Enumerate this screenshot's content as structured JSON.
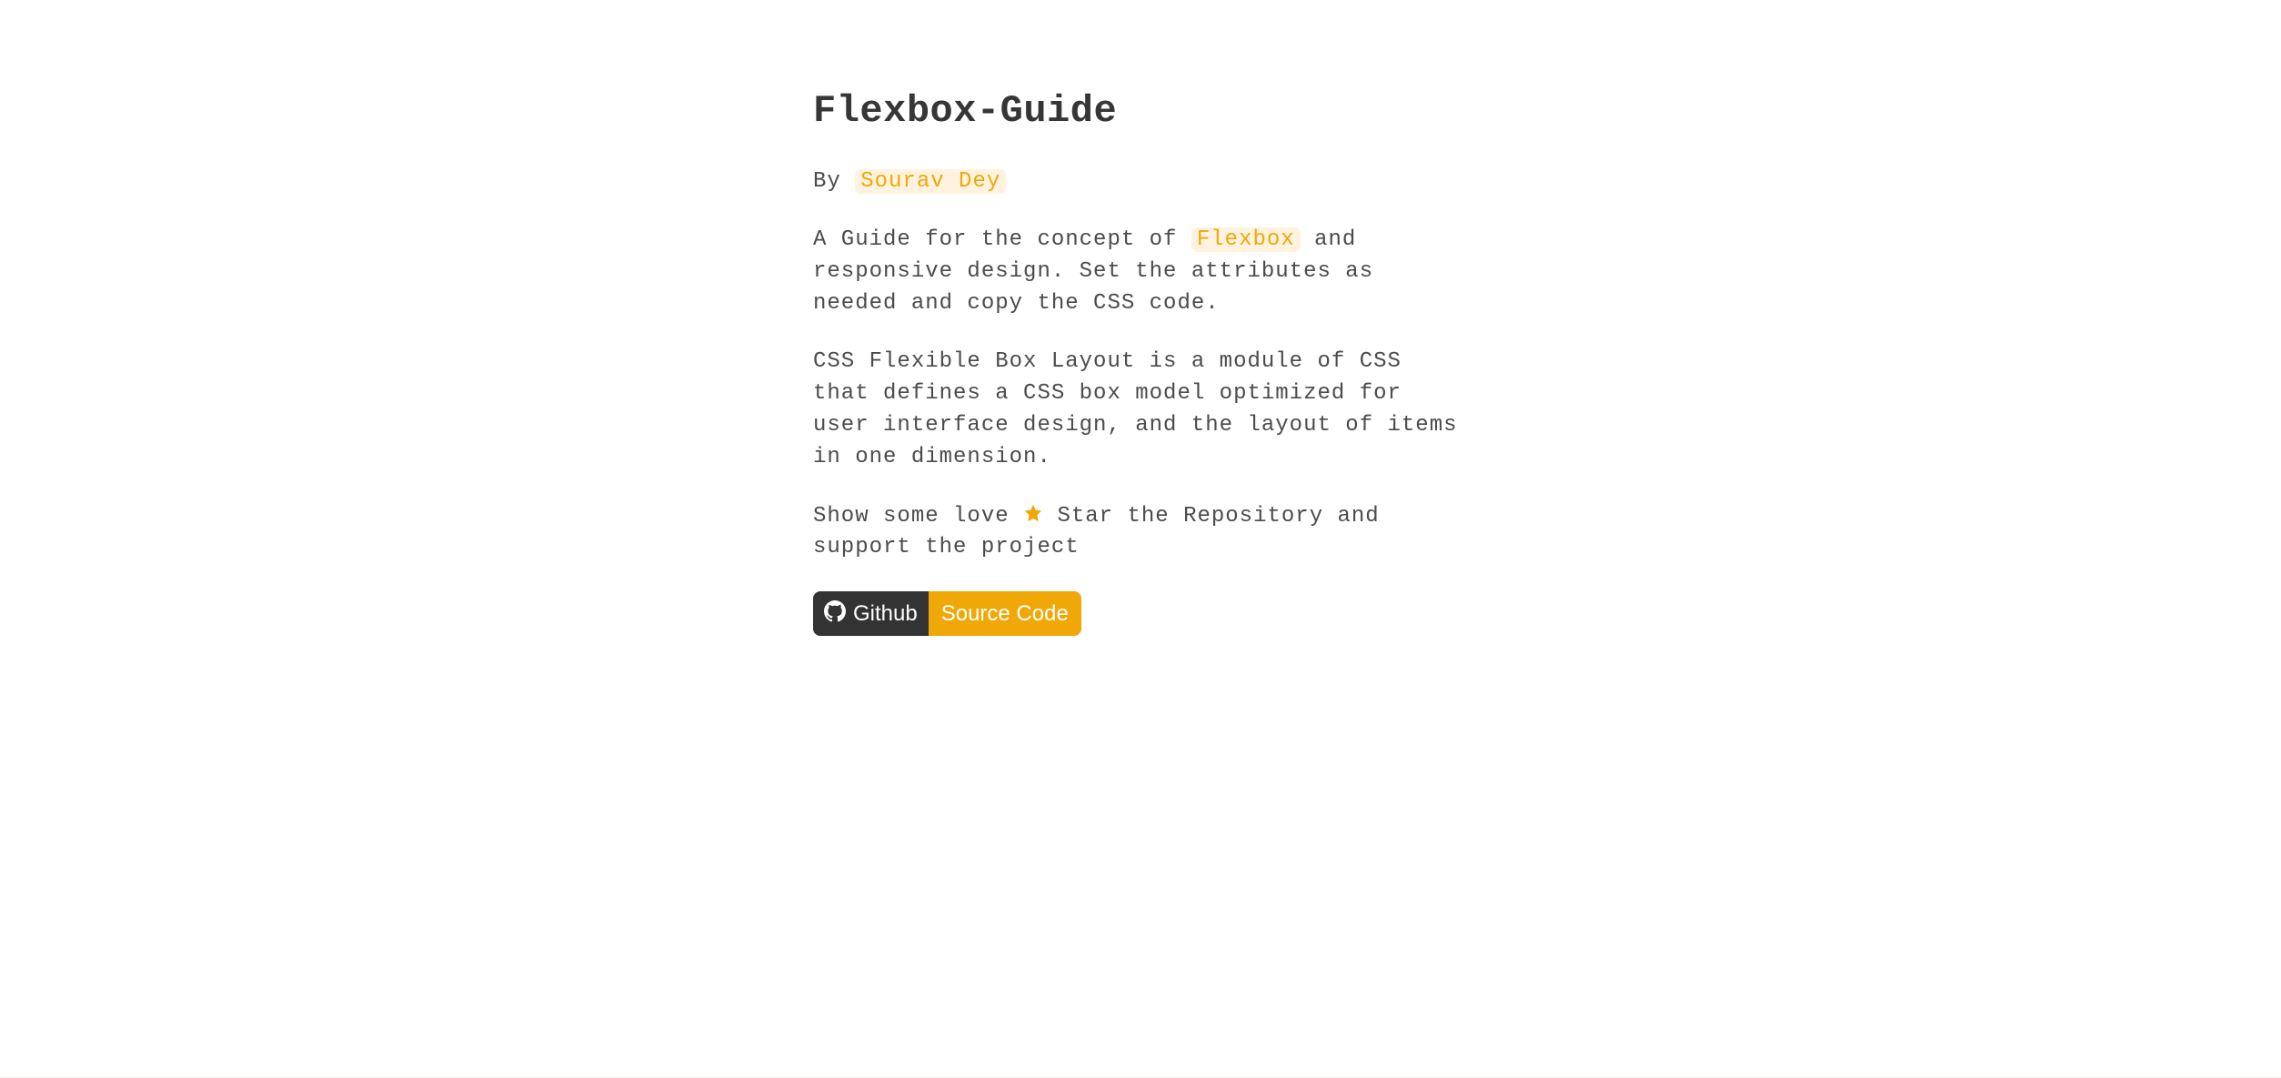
{
  "title": "Flexbox-Guide",
  "byline": {
    "prefix": "By ",
    "author": "Sourav Dey"
  },
  "intro": {
    "pre": "A Guide for the concept of ",
    "highlight": "Flexbox",
    "post": " and responsive design. Set the attributes as needed and copy the CSS code."
  },
  "css_module_para": "CSS Flexible Box Layout is a module of CSS that defines a CSS box model optimized for user interface design, and the layout of items in one dimension.",
  "love": {
    "pre": "Show some love ",
    "post": " Star the Repository and support the project"
  },
  "github_badge": {
    "left": "Github",
    "right": "Source Code"
  }
}
